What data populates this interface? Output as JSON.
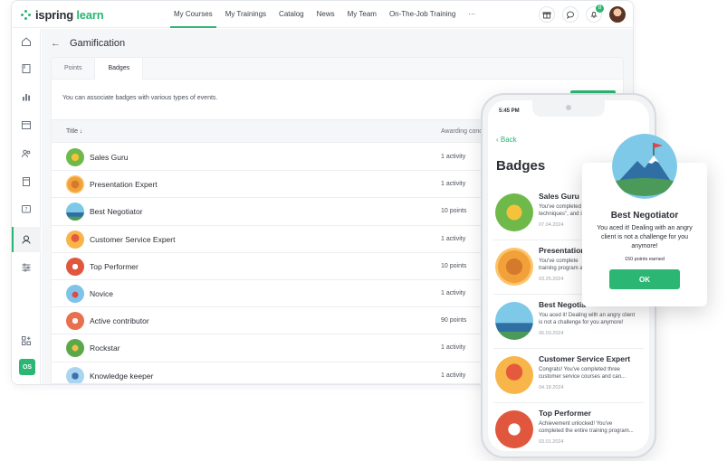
{
  "app": {
    "logo_prefix": "ispring",
    "logo_suffix": "learn",
    "nav": [
      "My Courses",
      "My Trainings",
      "Catalog",
      "News",
      "My Team",
      "On-The-Job Training",
      "···"
    ],
    "notification_count": "8",
    "user_initials": "OS"
  },
  "page": {
    "title": "Gamification",
    "tabs": [
      "Points",
      "Badges"
    ],
    "active_tab": "Badges",
    "description": "You can associate badges with various types of events.",
    "columns": {
      "title": "Title ↓",
      "awarding": "Awarding conditi"
    },
    "rows": [
      {
        "name": "Sales Guru",
        "award": "1 activity"
      },
      {
        "name": "Presentation Expert",
        "award": "1 activity"
      },
      {
        "name": "Best Negotiator",
        "award": "10 points"
      },
      {
        "name": "Customer Service Expert",
        "award": "1 activity"
      },
      {
        "name": "Top Performer",
        "award": "10 points"
      },
      {
        "name": "Novice",
        "award": "1 activity"
      },
      {
        "name": "Active contributor",
        "award": "90 points"
      },
      {
        "name": "Rockstar",
        "award": "1 activity"
      },
      {
        "name": "Knowledge keeper",
        "award": "1 activity"
      }
    ]
  },
  "phone": {
    "time": "5:45 PM",
    "back": "‹ Back",
    "title": "Badges",
    "items": [
      {
        "title": "Sales Guru",
        "desc": "You've completed\ntechniques\", and s",
        "date": "07.04.2024"
      },
      {
        "title": "Presentation",
        "desc": "You've complete\ntraining program a",
        "date": "03.25.2024"
      },
      {
        "title": "Best Negotia",
        "desc": "You aced it! Dealing with an angry client\nis not a challenge for you anymore!",
        "date": "06.03.2024"
      },
      {
        "title": "Customer Service Expert",
        "desc": "Congrats! You've completed three\ncustomer service courses and can...",
        "date": "04.18.2024"
      },
      {
        "title": "Top Performer",
        "desc": "Achievement unlocked! You've\ncompleted the entire training program...",
        "date": "03.01.2024"
      }
    ]
  },
  "popup": {
    "title": "Best Negotiator",
    "text": "You aced it! Dealing with an angry client is not a challenge for you anymore!",
    "points": "150 points earned",
    "ok": "OK"
  },
  "colors": {
    "accent": "#2bb673"
  }
}
